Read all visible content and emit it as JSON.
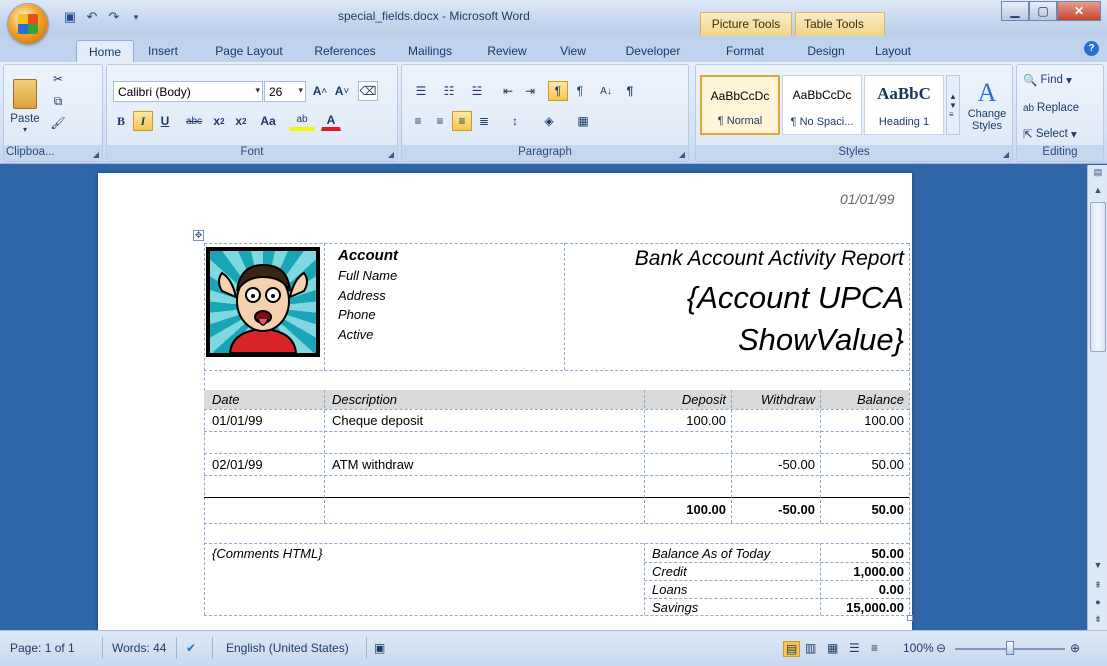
{
  "window": {
    "title": "special_fields.docx - Microsoft Word"
  },
  "context_tabs": {
    "picture_tools": "Picture Tools",
    "table_tools": "Table Tools"
  },
  "tabs": [
    "Home",
    "Insert",
    "Page Layout",
    "References",
    "Mailings",
    "Review",
    "View",
    "Developer",
    "Format",
    "Design",
    "Layout"
  ],
  "ribbon": {
    "clipboard": {
      "paste": "Paste",
      "label": "Clipboa..."
    },
    "font": {
      "family": "Calibri (Body)",
      "size": "26",
      "label": "Font"
    },
    "paragraph": {
      "label": "Paragraph"
    },
    "styles": {
      "items": [
        {
          "sample": "AaBbCcDc",
          "name": "¶ Normal"
        },
        {
          "sample": "AaBbCcDc",
          "name": "¶ No Spaci..."
        },
        {
          "sample": "AaBbC",
          "name": "Heading 1"
        }
      ],
      "change": "Change Styles",
      "label": "Styles"
    },
    "editing": {
      "find": "Find",
      "replace": "Replace",
      "select": "Select",
      "label": "Editing"
    }
  },
  "document": {
    "header_date": "01/01/99",
    "account": {
      "title": "Account",
      "fields": [
        "Full Name",
        "Address",
        "Phone",
        "Active"
      ]
    },
    "report_title": "Bank Account Activity Report",
    "barcode_field_line1": "{Account UPCA",
    "barcode_field_line2": "ShowValue}",
    "table": {
      "headers": [
        "Date",
        "Description",
        "Deposit",
        "Withdraw",
        "Balance"
      ],
      "rows": [
        {
          "date": "01/01/99",
          "desc": "Cheque deposit",
          "deposit": "100.00",
          "withdraw": "",
          "balance": "100.00"
        },
        {
          "date": "02/01/99",
          "desc": "ATM withdraw",
          "deposit": "",
          "withdraw": "-50.00",
          "balance": "50.00"
        }
      ],
      "totals": {
        "deposit": "100.00",
        "withdraw": "-50.00",
        "balance": "50.00"
      }
    },
    "comments": "{Comments HTML}",
    "summary": [
      {
        "label": "Balance As of Today",
        "value": "50.00"
      },
      {
        "label": "Credit",
        "value": "1,000.00"
      },
      {
        "label": "Loans",
        "value": "0.00"
      },
      {
        "label": "Savings",
        "value": "15,000.00"
      }
    ]
  },
  "status": {
    "page": "Page: 1 of 1",
    "words": "Words: 44",
    "language": "English (United States)",
    "zoom": "100%"
  }
}
